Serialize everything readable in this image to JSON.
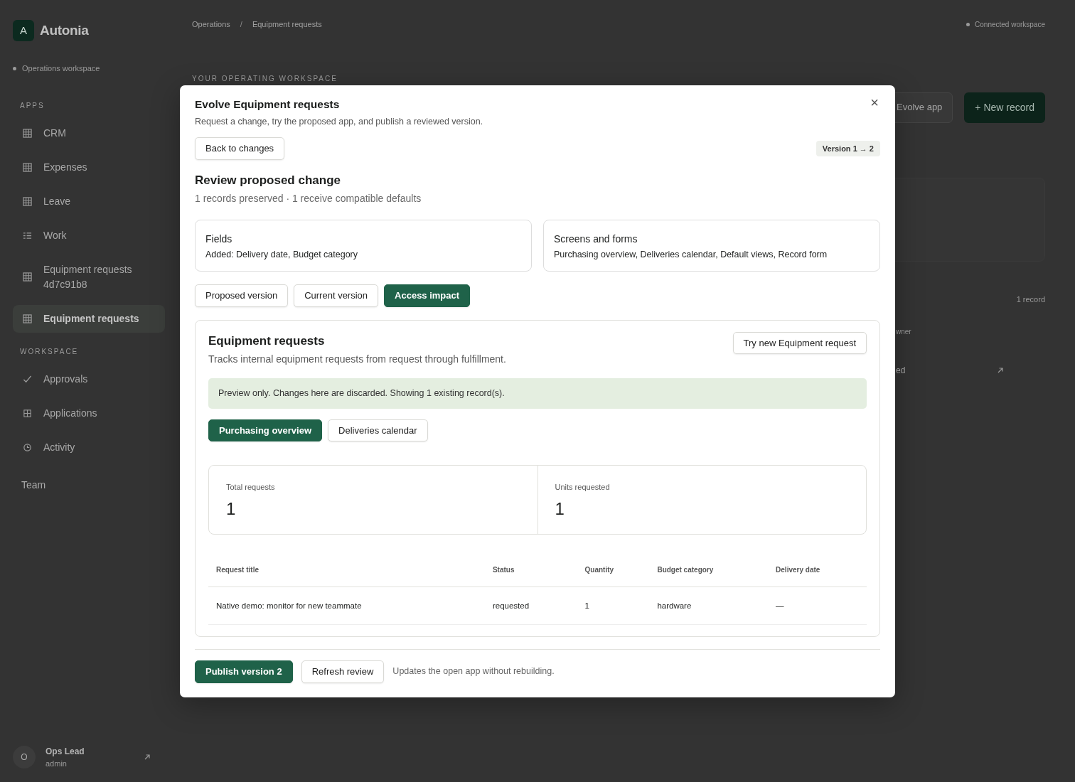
{
  "sidebar": {
    "brand": {
      "initial": "A",
      "name": "Autonia"
    },
    "workspace": "Operations workspace",
    "sections": [
      {
        "heading": "APPS",
        "items": [
          {
            "label": "CRM",
            "kind": "grid",
            "selected": false
          },
          {
            "label": "Expenses",
            "kind": "grid",
            "selected": false
          },
          {
            "label": "Leave",
            "kind": "grid",
            "selected": false
          },
          {
            "label": "Work",
            "kind": "list",
            "selected": false
          },
          {
            "label": "Equipment requests 4d7c91b8",
            "kind": "grid",
            "selected": false
          },
          {
            "label": "Equipment requests",
            "kind": "grid",
            "selected": true
          }
        ]
      },
      {
        "heading": "WORKSPACE",
        "items": [
          {
            "label": "Approvals",
            "kind": "check",
            "selected": false
          },
          {
            "label": "Applications",
            "kind": "apps",
            "selected": false
          },
          {
            "label": "Activity",
            "kind": "clock",
            "selected": false
          }
        ]
      }
    ],
    "team": "Team",
    "user": {
      "initial": "O",
      "name": "Ops Lead",
      "role": "admin"
    }
  },
  "breadcrumb": {
    "items": [
      "Operations",
      "Equipment requests"
    ],
    "separator": "/"
  },
  "connection": "Connected workspace",
  "page": {
    "eyebrow": "YOUR OPERATING WORKSPACE",
    "evolve_button": "Evolve app",
    "new_button": "+ New record",
    "record_count": "1 record",
    "column_fragment": "wner",
    "cell_fragment": "ed"
  },
  "modal": {
    "title": "Evolve Equipment requests",
    "subtitle": "Request a change, try the proposed app, and publish a reviewed version.",
    "close": "×",
    "back_button": "Back to changes",
    "version_badge": "Version 1 → 2",
    "review": {
      "title": "Review proposed change",
      "summary": "1 records preserved · 1 receive compatible defaults"
    },
    "summary_cards": [
      {
        "title": "Fields",
        "text": "Added: Delivery date, Budget category"
      },
      {
        "title": "Screens and forms",
        "text": "Purchasing overview, Deliveries calendar, Default views, Record form"
      }
    ],
    "view_tabs": [
      {
        "label": "Proposed version",
        "selected": false
      },
      {
        "label": "Current version",
        "selected": false
      },
      {
        "label": "Access impact",
        "selected": true
      }
    ],
    "preview": {
      "title": "Equipment requests",
      "description": "Tracks internal equipment requests from request through fulfillment.",
      "try_button": "Try new Equipment request",
      "notice": "Preview only. Changes here are discarded. Showing 1 existing record(s).",
      "screen_tabs": [
        {
          "label": "Purchasing overview",
          "selected": true
        },
        {
          "label": "Deliveries calendar",
          "selected": false
        }
      ],
      "metrics": [
        {
          "label": "Total requests",
          "value": "1"
        },
        {
          "label": "Units requested",
          "value": "1"
        }
      ],
      "table": {
        "columns": [
          "Request title",
          "Status",
          "Quantity",
          "Budget category",
          "Delivery date"
        ],
        "rows": [
          [
            "Native demo: monitor for new teammate",
            "requested",
            "1",
            "hardware",
            "—"
          ]
        ]
      }
    },
    "footer": {
      "publish_button": "Publish version 2",
      "refresh_button": "Refresh review",
      "note": "Updates the open app without rebuilding."
    }
  }
}
